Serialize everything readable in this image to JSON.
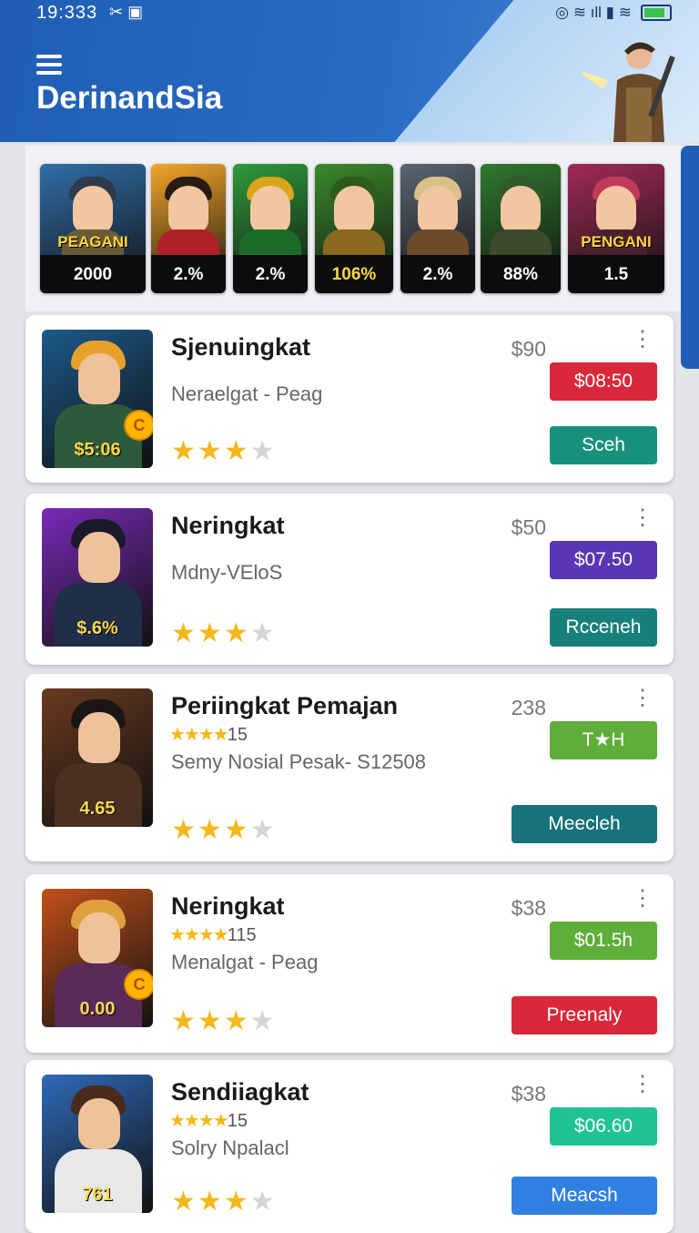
{
  "status_bar": {
    "time": "19:333",
    "left_icons": "✂ ▣",
    "right_icons": "◎ ≋ ıll ▮ ≋"
  },
  "header": {
    "title": "DerinandSia",
    "menu_icon": "hamburger-icon"
  },
  "carousel": [
    {
      "stamp": "PEAGANI",
      "value": "2000",
      "bg": "#2f6ea8",
      "hair": "#2e3b4a",
      "body": "#6b5a38"
    },
    {
      "stamp": "",
      "value": "2.%",
      "bg": "#f2a62a",
      "hair": "#2a1a14",
      "body": "#b0202a"
    },
    {
      "stamp": "",
      "value": "2.%",
      "bg": "#2f9a3c",
      "hair": "#d9a51a",
      "body": "#1d6b2a"
    },
    {
      "stamp": "",
      "value": "106%",
      "value_color": "#ffd640",
      "bg": "#3b8a2c",
      "hair": "#2e5a1c",
      "body": "#8a6a20"
    },
    {
      "stamp": "",
      "value": "2.%",
      "bg": "#5a6472",
      "hair": "#d9c088",
      "body": "#6c4a2a"
    },
    {
      "stamp": "",
      "value": "88%",
      "bg": "#2f7a30",
      "hair": "#2f5a2a",
      "body": "#3a4a2a"
    },
    {
      "stamp": "PENGANI",
      "value": "1.5",
      "bg": "#a02a56",
      "hair": "#c23a5a",
      "body": "#4a2030"
    }
  ],
  "items": [
    {
      "name": "Sjenuingkat",
      "subtitle": "Neraelgat - Peag",
      "minirate": "",
      "price": "$90",
      "tag": "$08:50",
      "tag_color": "#d8283a",
      "action": "Sceh",
      "action_color": "#17917c",
      "thumb_price": "$5:06",
      "coin": "C",
      "rating": 3,
      "thumb_bg": "#1d5a8a",
      "thumb_hair": "#e8a02a",
      "thumb_body": "#2c5a3a"
    },
    {
      "name": "Neringkat",
      "subtitle": "Mdny-VEloS",
      "minirate": "",
      "price": "$50",
      "tag": "$07.50",
      "tag_color": "#5a36b4",
      "action": "Rcceneh",
      "action_color": "#18807a",
      "thumb_price": "$.6%",
      "coin": "",
      "rating": 3,
      "thumb_bg": "#7a2ab8",
      "thumb_hair": "#1a1a2a",
      "thumb_body": "#1f2f4a"
    },
    {
      "name": "Periingkat Pemajan",
      "subtitle": "Semy Nosial Pesak- S12508",
      "minirate": "15",
      "price": "238",
      "tag": "T★H",
      "tag_color": "#5fae3a",
      "action": "Meecleh",
      "action_color": "#17727a",
      "thumb_price": "4.65",
      "coin": "",
      "rating": 3,
      "thumb_bg": "#6a3a20",
      "thumb_hair": "#1a1616",
      "thumb_body": "#4a3020"
    },
    {
      "name": "Neringkat",
      "subtitle": "Menalgat - Peag",
      "minirate": "115",
      "price": "$38",
      "tag": "$01.5h",
      "tag_color": "#5fae3a",
      "action": "Preenaly",
      "action_color": "#d8283a",
      "thumb_price": "0.00",
      "coin": "C",
      "rating": 3,
      "thumb_bg": "#c2501a",
      "thumb_hair": "#e0a040",
      "thumb_body": "#5a2a5a"
    },
    {
      "name": "Sendiiagkat",
      "subtitle": "Solry Npalacl",
      "minirate": "15",
      "price": "$38",
      "tag": "$06.60",
      "tag_color": "#20c494",
      "action": "Meacsh",
      "action_color": "#2f80e0",
      "thumb_price": "761",
      "coin": "",
      "rating": 3,
      "thumb_bg": "#2f6ab8",
      "thumb_hair": "#4a2a1a",
      "thumb_body": "#e8e8e8"
    }
  ]
}
